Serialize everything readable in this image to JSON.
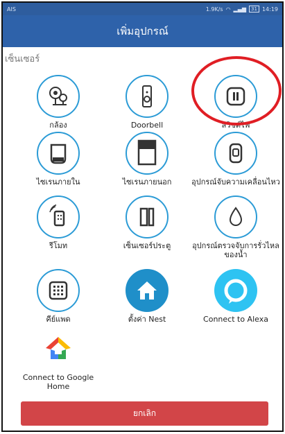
{
  "status_bar": {
    "carrier": "AIS",
    "speed": "1.9K/s",
    "battery": "31",
    "time": "14:19"
  },
  "header": {
    "title": "เพิ่มอุปกรณ์"
  },
  "section": {
    "label": "เซ็นเซอร์"
  },
  "devices": [
    {
      "label": "กล้อง",
      "icon": "camera-icon"
    },
    {
      "label": "Doorbell",
      "icon": "doorbell-icon"
    },
    {
      "label": "สวิชต์ไฟ",
      "icon": "light-switch-icon"
    },
    {
      "label": "ไซเรนภายใน",
      "icon": "indoor-siren-icon"
    },
    {
      "label": "ไซเรนภายนอก",
      "icon": "outdoor-siren-icon"
    },
    {
      "label": "อุปกรณ์จับความเคลื่อนไหว",
      "icon": "motion-sensor-icon"
    },
    {
      "label": "รีโมท",
      "icon": "remote-icon"
    },
    {
      "label": "เซ็นเซอร์ประตู",
      "icon": "door-sensor-icon"
    },
    {
      "label": "อุปกรณ์ตรวจจับการรั่วไหลของน้ำ",
      "icon": "water-leak-icon"
    },
    {
      "label": "คีย์แพด",
      "icon": "keypad-icon"
    },
    {
      "label": "ตั้งค่า Nest",
      "icon": "nest-home-icon"
    },
    {
      "label": "Connect to Alexa",
      "icon": "alexa-icon"
    },
    {
      "label": "Connect to Google Home",
      "icon": "google-home-icon"
    }
  ],
  "footer": {
    "cancel_label": "ยกเลิก"
  },
  "colors": {
    "appbar": "#2e62aa",
    "icon_ring": "#2b9bd6",
    "cancel": "#d24548",
    "highlight": "#e01e24"
  }
}
